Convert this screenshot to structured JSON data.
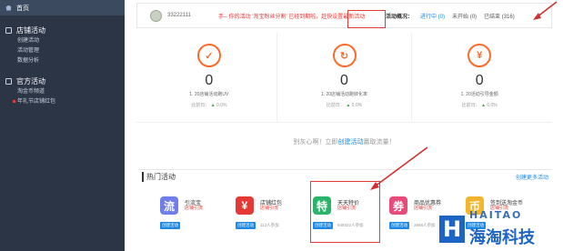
{
  "sidebar": {
    "home": "首页",
    "groups": [
      {
        "title": "店铺活动",
        "items": [
          "创建活动",
          "活动管理",
          "数据分析"
        ]
      },
      {
        "title": "官方活动",
        "items": [
          "淘金币频道",
          "年礼节店铺红包"
        ]
      }
    ]
  },
  "topbar": {
    "user_id": "33222111",
    "notice": "手-- 你的活动 '淘宝粉丝分割' 已经到期啦，赶快设置最新活动",
    "overview_label": "活动概况：",
    "ongoing": "进行中 (0)",
    "not_started": "未开始 (0)",
    "ended": "已结束 (316)"
  },
  "metrics": [
    {
      "icon": "chart-trend-icon",
      "glyph": "✓",
      "value": "0",
      "label": "1. 20店铺活动跑UV",
      "compare_label": "比前日：",
      "compare_value": "0.0%"
    },
    {
      "icon": "refresh-icon",
      "glyph": "↻",
      "value": "0",
      "label": "1. 20店铺活动跑转化率",
      "compare_label": "比前日：",
      "compare_value": "0.0%"
    },
    {
      "icon": "yen-icon",
      "glyph": "¥",
      "value": "0",
      "label": "1. 20活动引导金额",
      "compare_label": "比前日：",
      "compare_value": "0.0%"
    }
  ],
  "promo": {
    "before": "别灰心啊！立即",
    "link": "创建活动",
    "after": "赢取流量！"
  },
  "hot": {
    "title": "热门活动",
    "more": "创建更多活动",
    "items": [
      {
        "logo": "流",
        "color": "#6f7ee8",
        "name": "引流宝",
        "sub": "店铺引流",
        "button": "创建活动",
        "join": ""
      },
      {
        "logo": "¥",
        "color": "#e53935",
        "name": "店铺红包",
        "sub": "店铺引流",
        "button": "创建活动",
        "join": "113人参加"
      },
      {
        "logo": "特",
        "color": "#2bb36a",
        "name": "天天特价",
        "sub": "店铺引流",
        "button": "创建活动",
        "join": "848322人参加"
      },
      {
        "logo": "券",
        "color": "#e84a7a",
        "name": "商品优惠券",
        "sub": "店铺引流",
        "button": "创建活动",
        "join": "2858人参加"
      },
      {
        "logo": "币",
        "color": "#f2b52b",
        "name": "签到送淘金币",
        "sub": "店铺引流",
        "button": "创建活动",
        "join": ""
      }
    ]
  },
  "watermark": {
    "letter": "H",
    "brand": "HAITAO",
    "cn": "海淘科技"
  }
}
